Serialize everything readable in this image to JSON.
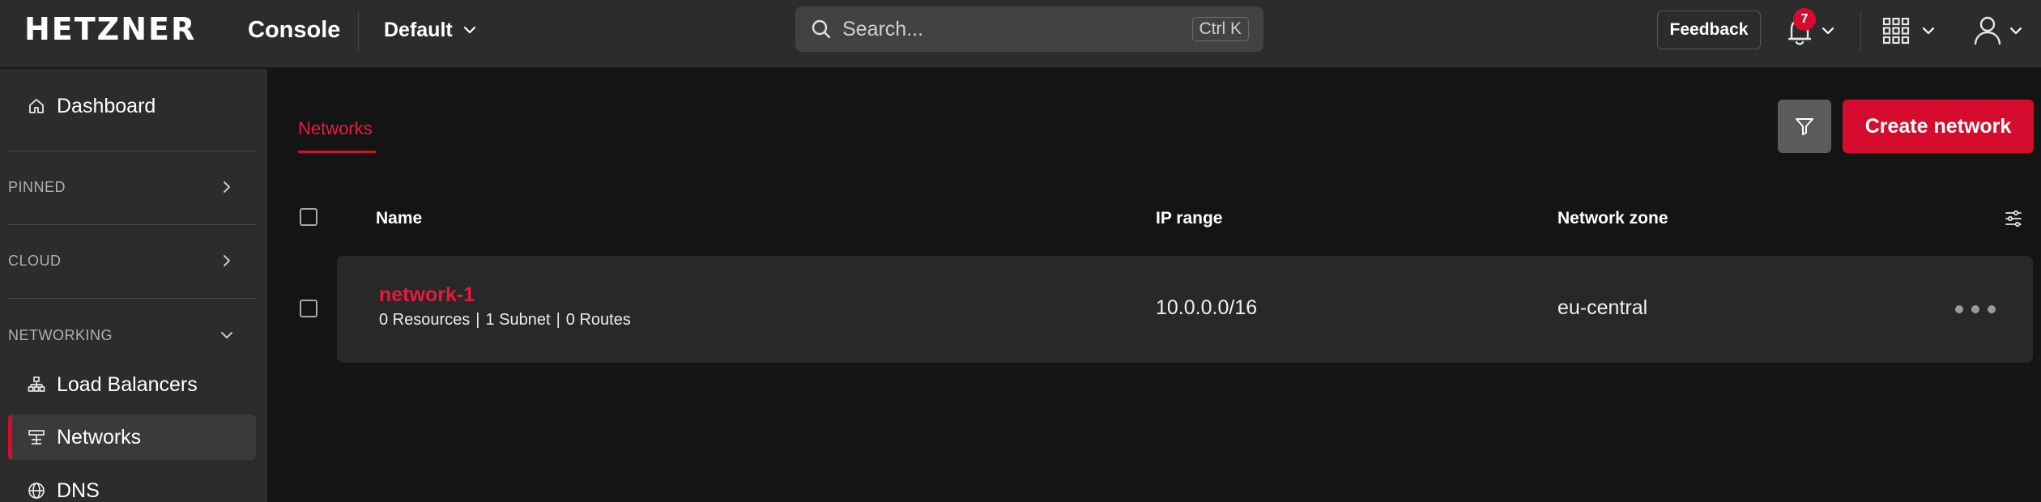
{
  "topbar": {
    "logo_text": "HETZNER",
    "console_label": "Console",
    "project": "Default",
    "search_placeholder": "Search...",
    "search_shortcut": "Ctrl K",
    "feedback_label": "Feedback",
    "notification_count": "7",
    "icons": [
      "search-icon",
      "chevron-down-icon",
      "bell-icon",
      "apps-grid-icon",
      "user-icon"
    ]
  },
  "sidebar": {
    "dashboard": "Dashboard",
    "sections": {
      "pinned": "PINNED",
      "cloud": "CLOUD",
      "networking": "NETWORKING"
    },
    "networking_items": [
      {
        "label": "Load Balancers",
        "icon": "load-balancer-icon"
      },
      {
        "label": "Networks",
        "icon": "network-icon",
        "active": true
      },
      {
        "label": "DNS",
        "icon": "globe-icon"
      }
    ]
  },
  "main": {
    "tab": "Networks",
    "create_label": "Create network",
    "columns": {
      "name": "Name",
      "ip_range": "IP range",
      "zone": "Network zone"
    },
    "rows": [
      {
        "name": "network-1",
        "resources": "0 Resources",
        "subnets": "1 Subnet",
        "routes": "0 Routes",
        "ip_range": "10.0.0.0/16",
        "zone": "eu-central"
      }
    ]
  },
  "colors": {
    "accent": "#d50c2d",
    "topbar_bg": "#2c2c2c",
    "page_bg": "#141414",
    "row_bg": "#282828"
  }
}
